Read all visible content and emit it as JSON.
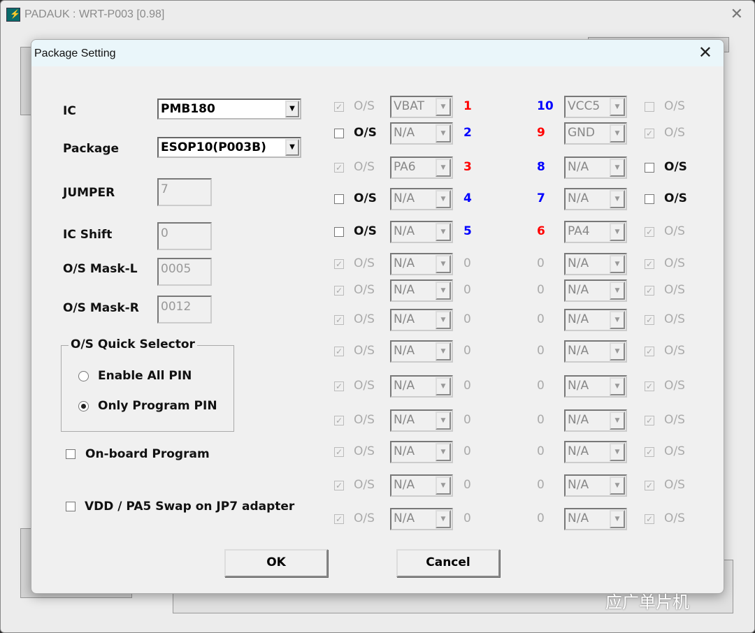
{
  "window": {
    "title": "PADAUK : WRT-P003 [0.98]"
  },
  "dialog": {
    "title": "Package Setting"
  },
  "form": {
    "ic_label": "IC",
    "ic_value": "PMB180",
    "package_label": "Package",
    "package_value": "ESOP10(P003B)",
    "jumper_label": "JUMPER",
    "jumper_value": "7",
    "icshift_label": "IC Shift",
    "icshift_value": "0",
    "maskl_label": "O/S Mask-L",
    "maskl_value": "0005",
    "maskr_label": "O/S Mask-R",
    "maskr_value": "0012",
    "quick_selector": {
      "title": "O/S Quick Selector",
      "options": [
        {
          "label": "Enable All PIN",
          "selected": false
        },
        {
          "label": "Only Program PIN",
          "selected": true
        }
      ]
    },
    "onboard": {
      "label": "On-board Program",
      "checked": false
    },
    "swap": {
      "label": "VDD / PA5 Swap on JP7 adapter",
      "checked": false
    }
  },
  "colors": {
    "red": "#ff0000",
    "blue": "#0000ff",
    "gray": "#aaaaaa"
  },
  "pins": {
    "os_label": "O/S",
    "left": [
      {
        "num": "1",
        "color": "red",
        "func": "VBAT",
        "checked": true,
        "enabled": false
      },
      {
        "num": "2",
        "color": "blue",
        "func": "N/A",
        "checked": false,
        "enabled": true
      },
      {
        "num": "3",
        "color": "red",
        "func": "PA6",
        "checked": true,
        "enabled": false
      },
      {
        "num": "4",
        "color": "blue",
        "func": "N/A",
        "checked": false,
        "enabled": true
      },
      {
        "num": "5",
        "color": "blue",
        "func": "N/A",
        "checked": false,
        "enabled": true
      },
      {
        "num": "0",
        "color": "gray",
        "func": "N/A",
        "checked": true,
        "enabled": false
      },
      {
        "num": "0",
        "color": "gray",
        "func": "N/A",
        "checked": true,
        "enabled": false
      },
      {
        "num": "0",
        "color": "gray",
        "func": "N/A",
        "checked": true,
        "enabled": false
      },
      {
        "num": "0",
        "color": "gray",
        "func": "N/A",
        "checked": true,
        "enabled": false
      },
      {
        "num": "0",
        "color": "gray",
        "func": "N/A",
        "checked": true,
        "enabled": false
      },
      {
        "num": "0",
        "color": "gray",
        "func": "N/A",
        "checked": true,
        "enabled": false
      },
      {
        "num": "0",
        "color": "gray",
        "func": "N/A",
        "checked": true,
        "enabled": false
      },
      {
        "num": "0",
        "color": "gray",
        "func": "N/A",
        "checked": true,
        "enabled": false
      },
      {
        "num": "0",
        "color": "gray",
        "func": "N/A",
        "checked": true,
        "enabled": false
      }
    ],
    "right": [
      {
        "num": "10",
        "color": "blue",
        "func": "VCC5",
        "checked": false,
        "enabled": false
      },
      {
        "num": "9",
        "color": "red",
        "func": "GND",
        "checked": true,
        "enabled": false
      },
      {
        "num": "8",
        "color": "blue",
        "func": "N/A",
        "checked": false,
        "enabled": true
      },
      {
        "num": "7",
        "color": "blue",
        "func": "N/A",
        "checked": false,
        "enabled": true
      },
      {
        "num": "6",
        "color": "red",
        "func": "PA4",
        "checked": true,
        "enabled": false
      },
      {
        "num": "0",
        "color": "gray",
        "func": "N/A",
        "checked": true,
        "enabled": false
      },
      {
        "num": "0",
        "color": "gray",
        "func": "N/A",
        "checked": true,
        "enabled": false
      },
      {
        "num": "0",
        "color": "gray",
        "func": "N/A",
        "checked": true,
        "enabled": false
      },
      {
        "num": "0",
        "color": "gray",
        "func": "N/A",
        "checked": true,
        "enabled": false
      },
      {
        "num": "0",
        "color": "gray",
        "func": "N/A",
        "checked": true,
        "enabled": false
      },
      {
        "num": "0",
        "color": "gray",
        "func": "N/A",
        "checked": true,
        "enabled": false
      },
      {
        "num": "0",
        "color": "gray",
        "func": "N/A",
        "checked": true,
        "enabled": false
      },
      {
        "num": "0",
        "color": "gray",
        "func": "N/A",
        "checked": true,
        "enabled": false
      },
      {
        "num": "0",
        "color": "gray",
        "func": "N/A",
        "checked": true,
        "enabled": false
      }
    ]
  },
  "buttons": {
    "ok": "OK",
    "cancel": "Cancel"
  },
  "watermark": "应广单片机"
}
